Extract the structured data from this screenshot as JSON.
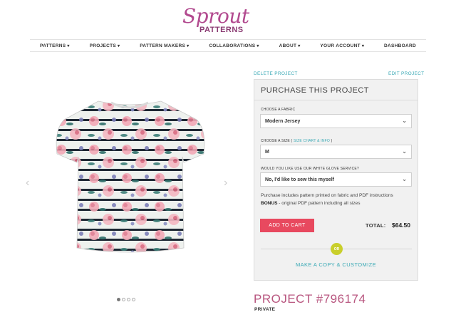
{
  "brand": {
    "script": "Sprout",
    "sub": "PATTERNS"
  },
  "nav": [
    {
      "label": "PATTERNS",
      "caret": "▾"
    },
    {
      "label": "PROJECTS",
      "caret": "▾"
    },
    {
      "label": "PATTERN MAKERS",
      "caret": "▾"
    },
    {
      "label": "COLLABORATIONS",
      "caret": "▾"
    },
    {
      "label": "ABOUT",
      "caret": "▾"
    },
    {
      "label": "YOUR ACCOUNT",
      "caret": "▾"
    },
    {
      "label": "DASHBOARD",
      "caret": ""
    }
  ],
  "links": {
    "delete": "DELETE PROJECT",
    "edit": "EDIT PROJECT"
  },
  "carousel": {
    "prev": "‹",
    "next": "›",
    "dots": 4,
    "active_dot": 0
  },
  "panel": {
    "title": "PURCHASE THIS PROJECT",
    "fabric_label": "CHOOSE A FABRIC",
    "fabric_value": "Modern Jersey",
    "size_label": "CHOOSE A SIZE",
    "size_link_open": " ( ",
    "size_link": "SIZE CHART & INFO",
    "size_link_close": " )",
    "size_value": "M",
    "glove_label": "WOULD YOU LIKE USE OUR WHITE GLOVE SERVICE?",
    "glove_value": "No, I'd like to sew this myself",
    "note_line1": "Purchase includes pattern printed on fabric and PDF instructions",
    "note_bonus": "BONUS",
    "note_line2": " - original PDF pattern including all sizes",
    "cart_button": "ADD TO CART",
    "total_label": "TOTAL:",
    "total_value": "$64.50",
    "or": "OR",
    "copy_link": "MAKE A COPY & CUSTOMIZE"
  },
  "project": {
    "title": "PROJECT #796174",
    "visibility": "PRIVATE"
  },
  "colors": {
    "accent_pink": "#e8495f",
    "teal_link": "#3aa9b5",
    "brand_purple": "#b24a8f",
    "or_badge": "#c9cf2b"
  }
}
